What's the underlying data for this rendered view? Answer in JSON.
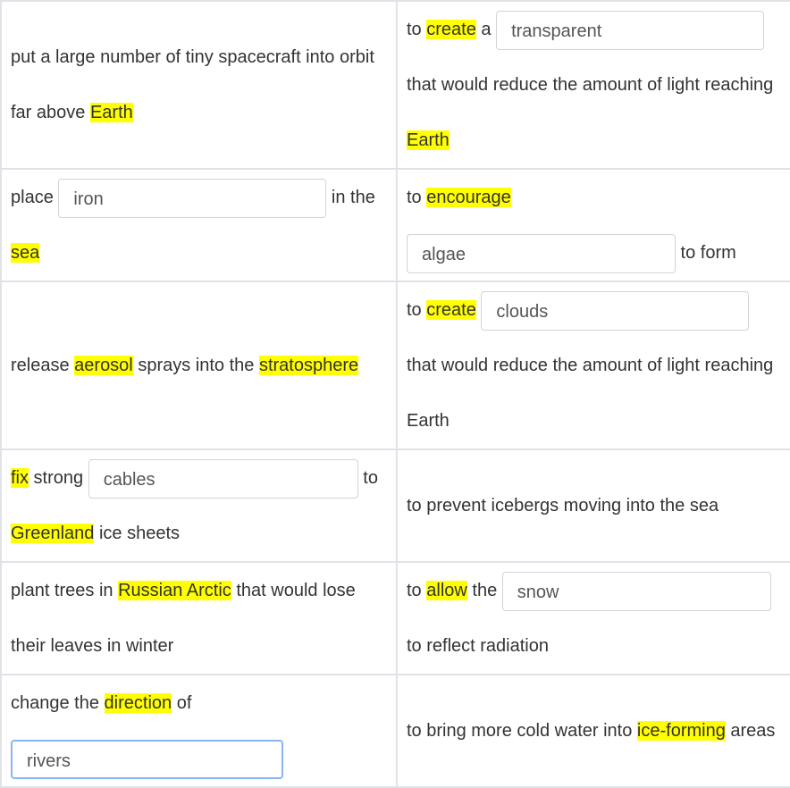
{
  "rows": [
    {
      "left": {
        "t1": "put a large number of tiny spacecraft into orbit far above ",
        "hl1": "Earth"
      },
      "right": {
        "t1": "to ",
        "hl1": "create",
        "t2": " a ",
        "gap": "transparent",
        "t3": " that would reduce the amount of light reaching ",
        "hl2": "Earth"
      }
    },
    {
      "left": {
        "t1": "place ",
        "gap": "iron",
        "t2": " in the ",
        "hl1": "sea"
      },
      "right": {
        "t1": "to ",
        "hl1": "encourage",
        "gap": "algae",
        "t2": " to form"
      }
    },
    {
      "left": {
        "t1": "release ",
        "hl1": "aerosol",
        "t2": " sprays into the ",
        "hl2": "stratosphere"
      },
      "right": {
        "t1": "to ",
        "hl1": "create",
        "gap": "clouds",
        "t2": " that would reduce the amount of light reaching Earth"
      }
    },
    {
      "left": {
        "hl1": "fix",
        "t1": " strong ",
        "gap": "cables",
        "t2": " to ",
        "hl2": "Greenland",
        "t3": " ice sheets"
      },
      "right": {
        "t1": "to prevent icebergs moving into the sea"
      }
    },
    {
      "left": {
        "t1": "plant trees in ",
        "hl1": "Russian Arctic",
        "t2": " that would lose their leaves in winter"
      },
      "right": {
        "t1": "to ",
        "hl1": "allow",
        "t2": " the ",
        "gap": "snow",
        "t3": " to reflect radiation"
      }
    },
    {
      "left": {
        "t1": "change the ",
        "hl1": "direction",
        "t2": " of ",
        "gap": "rivers"
      },
      "right": {
        "t1": "to bring more cold water into ",
        "hl1": "ice-forming",
        "t2": " areas"
      }
    }
  ]
}
